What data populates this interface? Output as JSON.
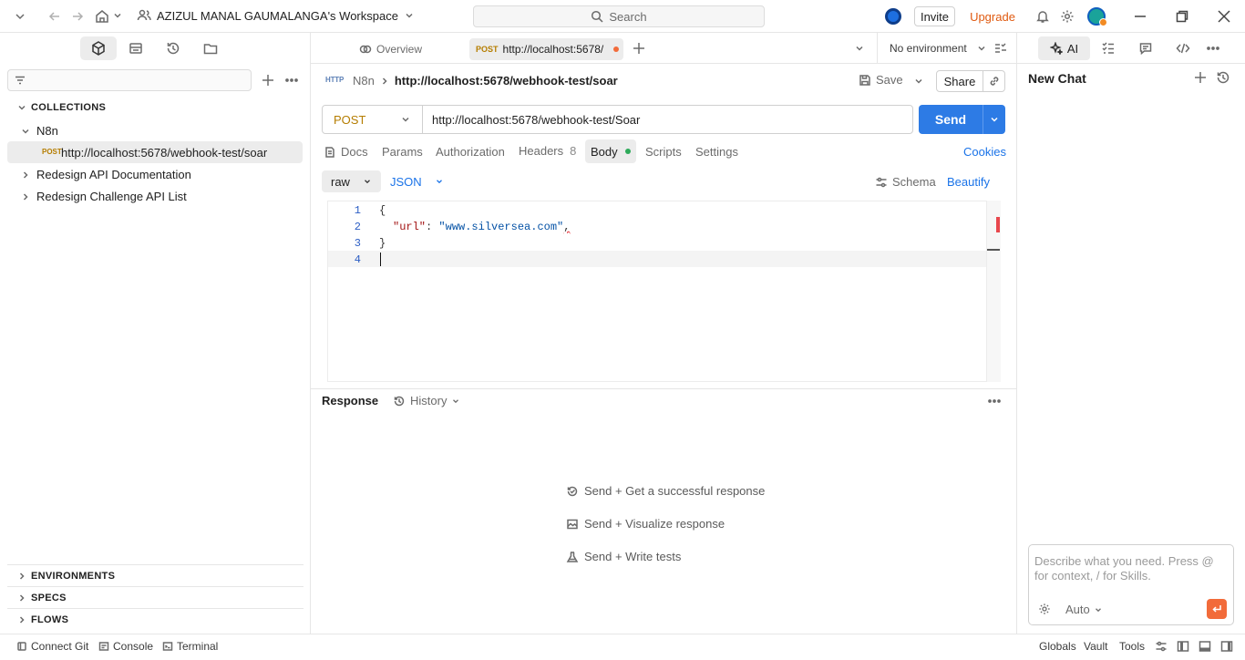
{
  "workspace": {
    "name": "AZIZUL MANAL GAUMALANGA's Workspace"
  },
  "search": {
    "label": "Search"
  },
  "topbar": {
    "invite": "Invite",
    "upgrade": "Upgrade"
  },
  "collections": {
    "header": "COLLECTIONS",
    "items": [
      {
        "name": "N8n",
        "expanded": true,
        "requests": [
          {
            "method": "POST",
            "label": "http://localhost:5678/webhook-test/soar"
          }
        ]
      },
      {
        "name": "Redesign API Documentation",
        "expanded": false
      },
      {
        "name": "Redesign Challenge API List",
        "expanded": false
      }
    ]
  },
  "sections": {
    "environments": "ENVIRONMENTS",
    "specs": "SPECS",
    "flows": "FLOWS"
  },
  "tabs": {
    "overview": "Overview",
    "active_method": "POST",
    "active_label": "http://localhost:5678/",
    "environment": "No environment"
  },
  "request": {
    "breadcrumb_parent": "N8n",
    "breadcrumb_title": "http://localhost:5678/webhook-test/soar",
    "save": "Save",
    "share": "Share",
    "method": "POST",
    "url": "http://localhost:5678/webhook-test/Soar",
    "send": "Send",
    "subtabs": {
      "docs": "Docs",
      "params": "Params",
      "authorization": "Authorization",
      "headers": "Headers",
      "headers_count": "8",
      "body": "Body",
      "scripts": "Scripts",
      "settings": "Settings"
    },
    "cookies": "Cookies",
    "body_mode": "raw",
    "body_format": "JSON",
    "schema": "Schema",
    "beautify": "Beautify",
    "code": {
      "line_numbers": [
        "1",
        "2",
        "3",
        "4"
      ],
      "open_brace": "{",
      "key": "\"url\"",
      "colon": ": ",
      "value": "\"www.silversea.com\"",
      "comma": ",",
      "close_brace": "}"
    }
  },
  "response": {
    "title": "Response",
    "history": "History",
    "hints": [
      "Send + Get a successful response",
      "Send + Visualize response",
      "Send + Write tests"
    ]
  },
  "ai": {
    "tab": "AI",
    "title": "New Chat",
    "placeholder": "Describe what you need. Press @ for context, / for Skills.",
    "mode": "Auto"
  },
  "statusbar": {
    "connect_git": "Connect Git",
    "console": "Console",
    "terminal": "Terminal",
    "globals": "Globals",
    "vault": "Vault",
    "tools": "Tools"
  },
  "colors": {
    "accent": "#1a73e8",
    "post": "#b57d00",
    "upgrade": "#e05a10",
    "send": "#2d7be5"
  }
}
